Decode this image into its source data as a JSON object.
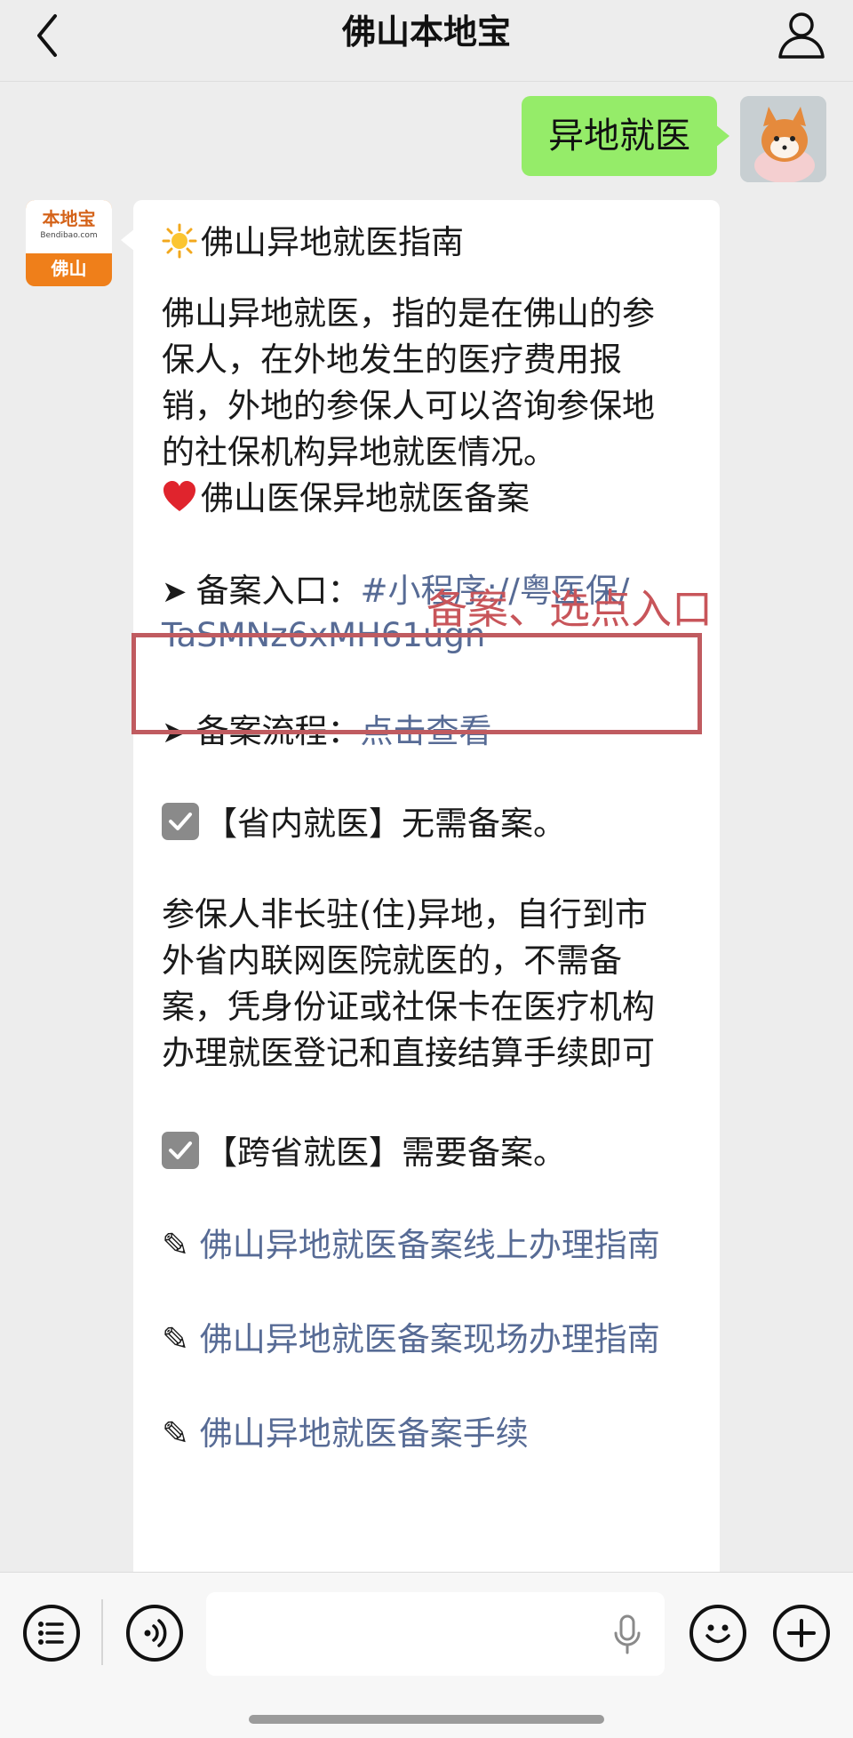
{
  "header": {
    "title": "佛山本地宝"
  },
  "outgoing_message": {
    "text": "异地就医"
  },
  "bot": {
    "avatar_logo": "本地宝",
    "avatar_logo_sub": "Bendibao.com",
    "avatar_city": "佛山"
  },
  "guide": {
    "heading": "佛山异地就医指南",
    "intro": [
      "佛山异地就医，指的是在佛山的参",
      "保人，在外地发生的医疗费用报",
      "销，外地的参保人可以咨询参保地",
      "的社保机构异地就医情况。"
    ],
    "record_heading": "佛山医保异地就医备案",
    "entry_label": "备案入口：",
    "entry_link_1": "#小程序://粤医保/",
    "entry_link_2": "TaSMNz6xMH61ugn",
    "process_label": "备案流程：",
    "process_link": "点击查看",
    "province_title": "【省内就医】无需备案。",
    "province_text": [
      "参保人非长驻(住)异地，自行到市",
      "外省内联网医院就医的，不需备",
      "案，凭身份证或社保卡在医疗机构",
      "办理就医登记和直接结算手续即可"
    ],
    "cross_title": "【跨省就医】需要备案。",
    "links": [
      "佛山异地就医备案线上办理指南",
      "佛山异地就医备案现场办理指南",
      "佛山异地就医备案手续"
    ]
  },
  "annotation": {
    "text": "备案、选点入口",
    "color": "#c8555a"
  },
  "colors": {
    "outgoing_bubble": "#95ec69",
    "link": "#576b95",
    "background": "#ededed"
  },
  "icons": {
    "heading": "sun-icon",
    "record": "red-heart-icon",
    "bullet": "arrow-right-icon",
    "check": "checkbox-checked-icon",
    "link": "pencil-icon"
  }
}
